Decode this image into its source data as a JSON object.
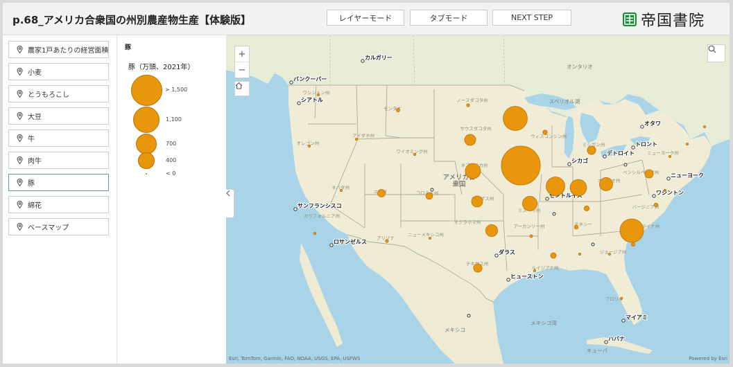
{
  "header": {
    "title": "p.68_アメリカ合衆国の州別農産物生産【体験版】",
    "buttons": [
      "レイヤーモード",
      "タブモード",
      "NEXT STEP"
    ],
    "logo_text": "帝国書院"
  },
  "sidebar": {
    "selected_index": 6,
    "items": [
      {
        "label": "農家1戸あたりの経営面積"
      },
      {
        "label": "小麦"
      },
      {
        "label": "とうもろこし"
      },
      {
        "label": "大豆"
      },
      {
        "label": "牛"
      },
      {
        "label": "肉牛"
      },
      {
        "label": "豚"
      },
      {
        "label": "綿花"
      },
      {
        "label": "ベースマップ"
      }
    ]
  },
  "legend": {
    "layer_name": "豚",
    "title": "豚（万頭、2021年）",
    "classes": [
      {
        "label": "> 1,500",
        "value": 1500
      },
      {
        "label": "1,100",
        "value": 1100
      },
      {
        "label": "700",
        "value": 700
      },
      {
        "label": "400",
        "value": 400
      },
      {
        "label": "< 0",
        "value": 0
      }
    ],
    "symbol_color": "#e8960c",
    "symbol_stroke": "#b8730a"
  },
  "map": {
    "controls": {
      "zoom_in": "+",
      "zoom_out": "−"
    },
    "attribution": "Esri, TomTom, Garmin, FAO, NOAA, USGS, EPA, USFWS",
    "powered_by": "Powered by Esri",
    "colors": {
      "water": "#a9d4e8",
      "land_us": "#f0ecd6",
      "land_canada": "#e6ecd6",
      "land_mexico": "#eeead3",
      "border": "#9a9a8a"
    },
    "cities": [
      {
        "name": "カルガリー"
      },
      {
        "name": "バンクーバー"
      },
      {
        "name": "シアトル"
      },
      {
        "name": "オタワ"
      },
      {
        "name": "トロント"
      },
      {
        "name": "デトロイト"
      },
      {
        "name": "シカゴ"
      },
      {
        "name": "ニューヨーク"
      },
      {
        "name": "ワシントン"
      },
      {
        "name": "セントルイス"
      },
      {
        "name": "サンフランシスコ"
      },
      {
        "name": "ロサンゼルス"
      },
      {
        "name": "ダラス"
      },
      {
        "name": "ヒューストン"
      },
      {
        "name": "マイアミ"
      },
      {
        "name": "ハバナ"
      }
    ],
    "regions": [
      {
        "name": "アメリカ合\n衆国"
      },
      {
        "name": "メキシコ"
      },
      {
        "name": "メキシコ湾"
      },
      {
        "name": "オンタリオ"
      },
      {
        "name": "スペリオル湖"
      },
      {
        "name": "キューバ"
      }
    ],
    "states": [
      {
        "name": "ワシントン州"
      },
      {
        "name": "オレゴン州"
      },
      {
        "name": "アイダホ州"
      },
      {
        "name": "モンタナ"
      },
      {
        "name": "ワイオミング州"
      },
      {
        "name": "ノースダコタ州"
      },
      {
        "name": "サウスダコタ州"
      },
      {
        "name": "ネブラスカ州"
      },
      {
        "name": "カンザス州"
      },
      {
        "name": "コロラド州"
      },
      {
        "name": "ユタ州"
      },
      {
        "name": "ネバダ州"
      },
      {
        "name": "カリフォルニア州"
      },
      {
        "name": "アリゾナ"
      },
      {
        "name": "ニューメキシコ州"
      },
      {
        "name": "オクラホマ州"
      },
      {
        "name": "テキサス州"
      },
      {
        "name": "ミズーリ州"
      },
      {
        "name": "アーカンソー州"
      },
      {
        "name": "ルイジアナ州"
      },
      {
        "name": "ウィスコンシン州"
      },
      {
        "name": "ミシガン州"
      },
      {
        "name": "オハイオ州"
      },
      {
        "name": "ペンシルベニア州"
      },
      {
        "name": "ニューヨーク州"
      },
      {
        "name": "テネシー"
      },
      {
        "name": "ジョージア州"
      },
      {
        "name": "フロリダ"
      },
      {
        "name": "ノースカロライナ州"
      },
      {
        "name": "バージニア州"
      }
    ],
    "hogs": [
      {
        "state": "アイオワ",
        "value": 2350
      },
      {
        "state": "ミネソタ",
        "value": 900
      },
      {
        "state": "ノースカロライナ",
        "value": 860
      },
      {
        "state": "イリノイ",
        "value": 540
      },
      {
        "state": "インディアナ",
        "value": 420
      },
      {
        "state": "ネブラスカ",
        "value": 360
      },
      {
        "state": "ミズーリ",
        "value": 330
      },
      {
        "state": "オハイオ",
        "value": 270
      },
      {
        "state": "オクラホマ",
        "value": 220
      },
      {
        "state": "カンザス",
        "value": 190
      },
      {
        "state": "サウスダコタ",
        "value": 190
      },
      {
        "state": "テキサス",
        "value": 110
      },
      {
        "state": "ペンシルベニア",
        "value": 110
      },
      {
        "state": "ユタ",
        "value": 90
      },
      {
        "state": "コロラド",
        "value": 70
      },
      {
        "state": "ミシガン",
        "value": 110
      },
      {
        "state": "ウィスコンシン",
        "value": 30
      },
      {
        "state": "モンタナ",
        "value": 20
      },
      {
        "state": "ワイオミング",
        "value": 9
      },
      {
        "state": "アイダホ",
        "value": 3
      },
      {
        "state": "オレゴン",
        "value": 1
      },
      {
        "state": "ワシントン",
        "value": 1
      },
      {
        "state": "ノースダコタ",
        "value": 14
      },
      {
        "state": "ネバダ",
        "value": 1
      },
      {
        "state": "カリフォルニア",
        "value": 7
      },
      {
        "state": "アリゾナ",
        "value": 14
      },
      {
        "state": "ニューメキシコ",
        "value": 1
      },
      {
        "state": "アーカンソー",
        "value": 12
      },
      {
        "state": "ルイジアナ",
        "value": 1
      },
      {
        "state": "ミシシッピ",
        "value": 47
      },
      {
        "state": "アラバマ",
        "value": 5
      },
      {
        "state": "テネシー",
        "value": 24
      },
      {
        "state": "ケンタッキー",
        "value": 40
      },
      {
        "state": "ジョージア",
        "value": 6
      },
      {
        "state": "サウスカロライナ",
        "value": 20
      },
      {
        "state": "バージニア",
        "value": 23
      },
      {
        "state": "ニューヨーク",
        "value": 5
      },
      {
        "state": "フロリダ",
        "value": 1
      },
      {
        "state": "メリーランド",
        "value": 2
      },
      {
        "state": "バーモント",
        "value": 1
      },
      {
        "state": "メイン",
        "value": 1
      }
    ]
  }
}
